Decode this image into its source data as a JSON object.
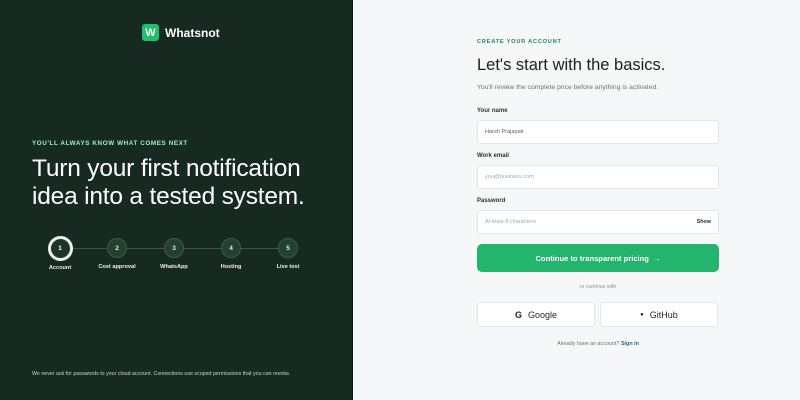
{
  "brand": {
    "logo_letter": "W",
    "name": "Whatsnot",
    "accent": "#1fbf6c"
  },
  "hero": {
    "eyebrow": "YOU'LL ALWAYS KNOW WHAT COMES NEXT",
    "headline": "Turn your first notification idea into a tested system.",
    "footnote": "We never ask for passwords to your cloud account. Connections use scoped permissions that you can revoke."
  },
  "steps": [
    {
      "number": "1",
      "label": "Account",
      "active": true
    },
    {
      "number": "2",
      "label": "Cost approval",
      "active": false
    },
    {
      "number": "3",
      "label": "WhatsApp",
      "active": false
    },
    {
      "number": "4",
      "label": "Hosting",
      "active": false
    },
    {
      "number": "5",
      "label": "Live test",
      "active": false
    }
  ],
  "form": {
    "eyebrow": "CREATE YOUR ACCOUNT",
    "title": "Let's start with the basics.",
    "subtitle": "You'll review the complete price before anything is activated.",
    "name_label": "Your name",
    "name_value": "Harsh Prajapati",
    "email_label": "Work email",
    "email_placeholder": "you@business.com",
    "password_label": "Password",
    "password_placeholder": "At least 8 characters",
    "show_label": "Show",
    "cta_label": "Continue to transparent pricing",
    "cta_arrow": "→",
    "divider_text": "or continue with",
    "google_icon": "G",
    "google_label": "Google",
    "github_icon": "●",
    "github_label": "GitHub",
    "signin_prompt": "Already have an account?",
    "signin_link": "Sign in",
    "cta_color": "#23b46e"
  }
}
